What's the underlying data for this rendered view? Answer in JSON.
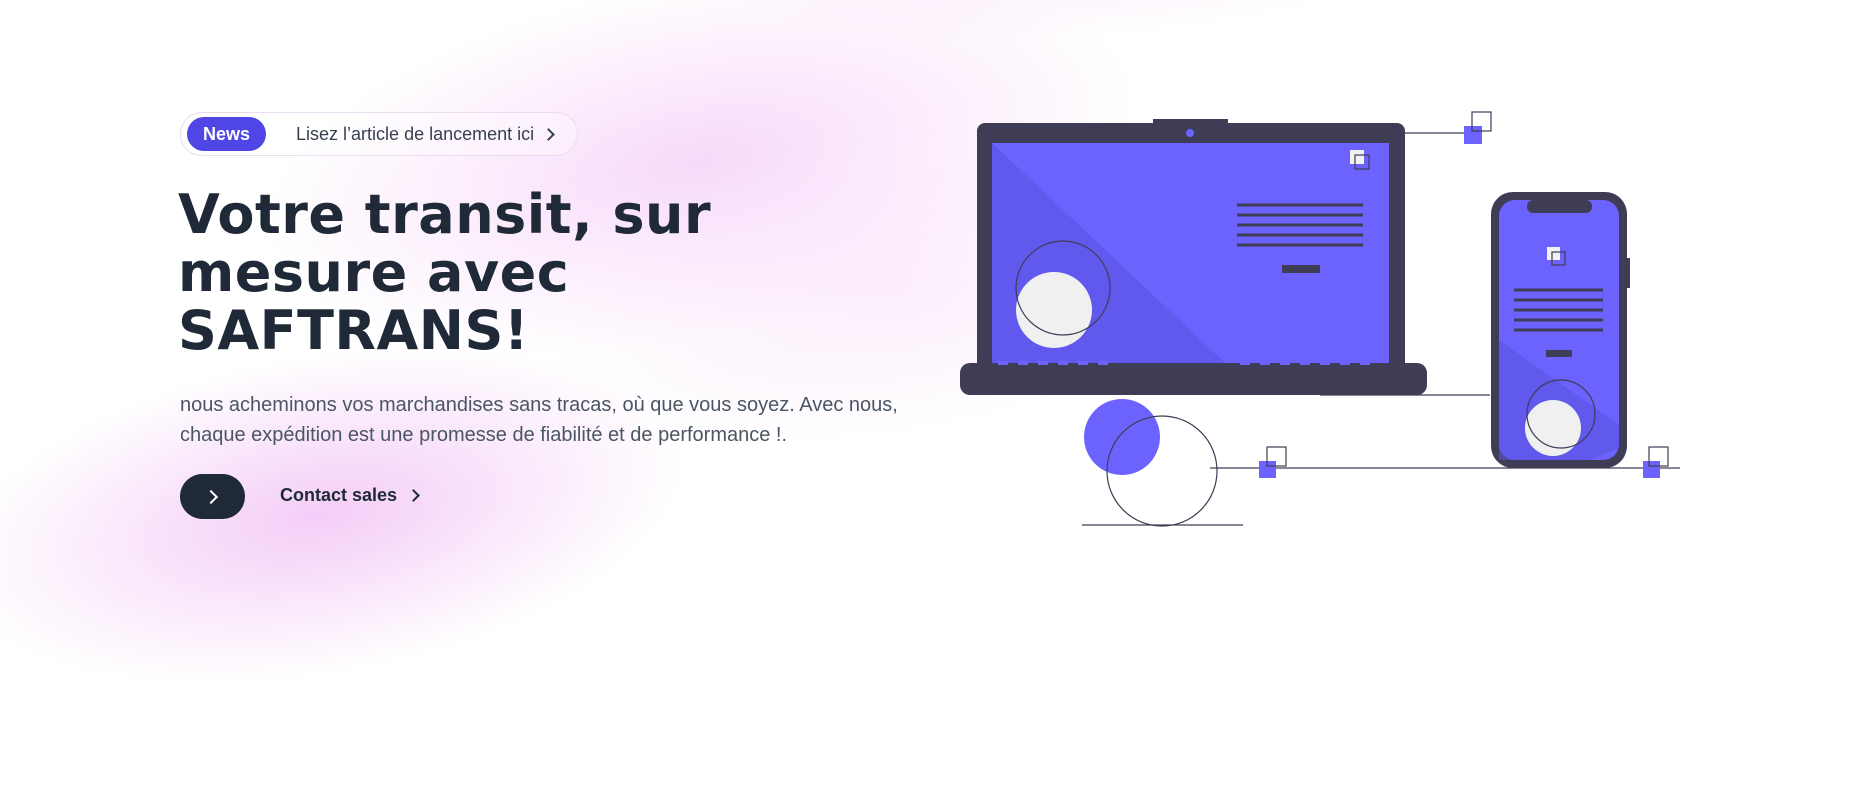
{
  "announcement": {
    "badge": "News",
    "text": "Lisez l’article de lancement ici"
  },
  "hero": {
    "title": "Votre transit, sur mesure avec SAFTRANS!",
    "subtitle": "nous acheminons vos marchandises sans tracas, où que vous soyez. Avec nous, chaque expédition est une promesse de fiabilité et de performance !."
  },
  "actions": {
    "primary_icon": "chevron-right-icon",
    "contact_label": "Contact sales"
  },
  "illustration": {
    "name": "devices-illustration",
    "accent_color": "#6c63ff",
    "dark_color": "#3f3d56"
  },
  "colors": {
    "badge": "#4f46e5",
    "text_dark": "#1f2937",
    "text_muted": "#4b5563",
    "glow": "#f5cdf8"
  }
}
